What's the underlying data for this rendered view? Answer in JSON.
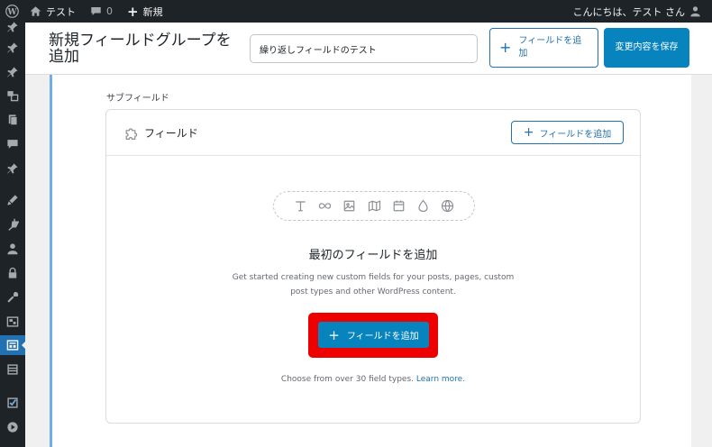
{
  "adminbar": {
    "site_name": "テスト",
    "comments_count": "0",
    "new_label": "新規",
    "greeting": "こんにちは、テスト さん"
  },
  "sidemenu": {
    "icons": [
      "pushpin-icon",
      "pushpin-icon",
      "pushpin-icon",
      "media-icon",
      "pages-icon",
      "comments-icon",
      "pushpin-icon",
      "appearance-icon",
      "plugins-icon",
      "users-icon",
      "lock-icon",
      "tools-icon",
      "settings-icon",
      "acf-field-groups-icon",
      "table-icon",
      "checkbox-icon",
      "play-icon"
    ]
  },
  "header": {
    "page_title": "新規フィールドグループを追加",
    "title_input_value": "繰り返しフィールドのテスト",
    "add_field_button": "フィールドを追加",
    "save_button": "変更内容を保存"
  },
  "panel": {
    "sub_label": "サブフィールド",
    "card_title": "フィールド",
    "card_add_button": "フィールドを追加",
    "field_type_icons": [
      "text-icon",
      "infinity-icon",
      "image-icon",
      "map-icon",
      "calendar-icon",
      "drop-icon",
      "globe-icon"
    ],
    "empty_title": "最初のフィールドを追加",
    "empty_description": "Get started creating new custom fields for your posts, pages, custom post types and other WordPress content.",
    "main_add_button": "フィールドを追加",
    "footnote_text": "Choose from over 30 field types.",
    "footnote_link": "Learn more."
  },
  "colors": {
    "adminbar_bg": "#1d2327",
    "accent": "#2271b1",
    "primary_button": "#0783be",
    "highlight": "#ee0000"
  }
}
